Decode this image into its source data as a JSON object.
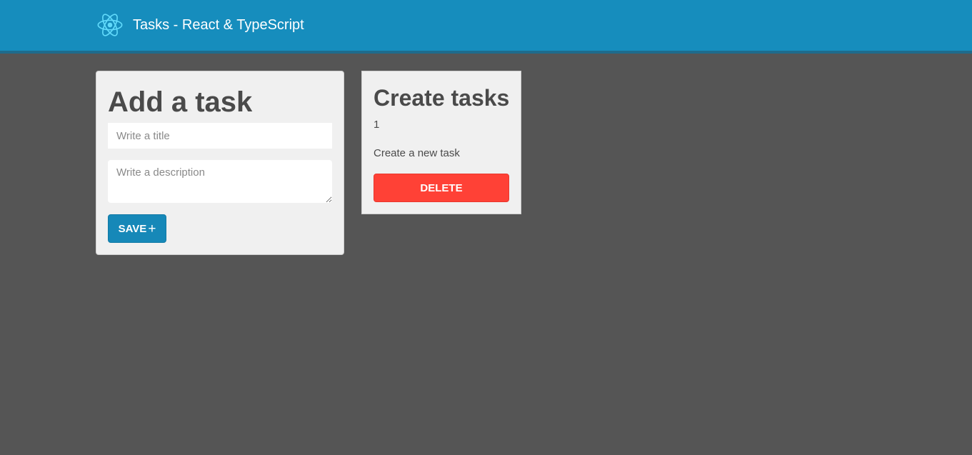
{
  "navbar": {
    "brand_icon": "react-logo-icon",
    "title": "Tasks - React & TypeScript"
  },
  "add_task_form": {
    "heading": "Add a task",
    "title_placeholder": "Write a title",
    "title_value": "",
    "description_placeholder": "Write a description",
    "description_value": "",
    "save_label": "SAVE",
    "save_icon": "plus-icon",
    "save_icon_glyph": "+"
  },
  "tasks": [
    {
      "title": "Create tasks",
      "id": "1",
      "description": "Create a new task",
      "delete_label": "DELETE"
    }
  ],
  "colors": {
    "navbar": "#168dbd",
    "background": "#555555",
    "card": "#f0f0f0",
    "save_button": "#1688b8",
    "delete_button": "#ff4136",
    "react_logo": "#61dafb"
  }
}
